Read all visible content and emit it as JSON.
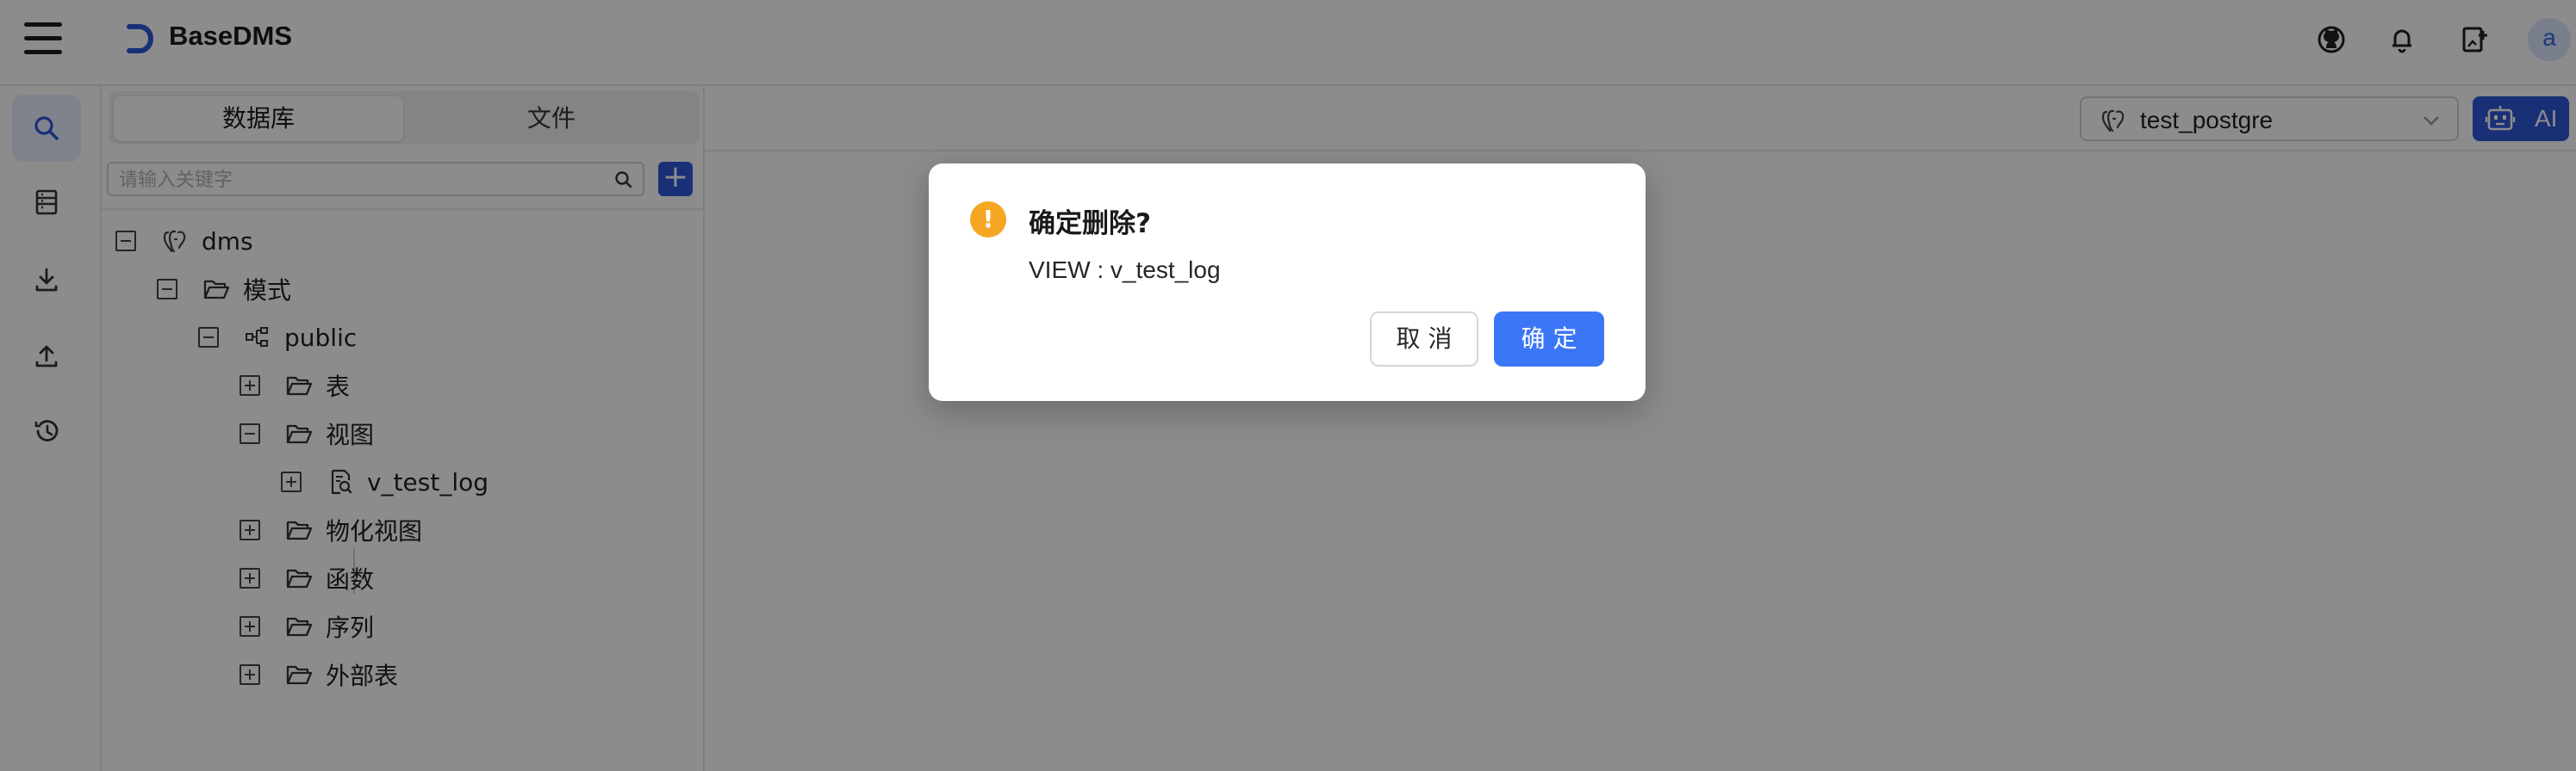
{
  "app": {
    "title": "BaseDMS"
  },
  "header": {
    "icons": [
      "github-icon",
      "bell-icon",
      "add-document-icon"
    ],
    "avatar": "a"
  },
  "leftnav": {
    "items": [
      {
        "icon": "search-icon",
        "active": true
      },
      {
        "icon": "database-icon",
        "active": false
      },
      {
        "icon": "download-icon",
        "active": false
      },
      {
        "icon": "upload-icon",
        "active": false
      },
      {
        "icon": "history-icon",
        "active": false
      }
    ]
  },
  "tree_panel": {
    "tabs": [
      {
        "label": "数据库",
        "selected": true
      },
      {
        "label": "文件",
        "selected": false
      }
    ],
    "search": {
      "placeholder": "请输入关键字",
      "value": ""
    },
    "add_label": "+",
    "nodes": [
      {
        "label": "dms",
        "icon": "postgres-icon",
        "expanded": true,
        "depth": 0
      },
      {
        "label": "模式",
        "icon": "folder-open-icon",
        "expanded": true,
        "depth": 1
      },
      {
        "label": "public",
        "icon": "schema-icon",
        "expanded": true,
        "depth": 2
      },
      {
        "label": "表",
        "icon": "folder-open-icon",
        "expanded": false,
        "depth": 3
      },
      {
        "label": "视图",
        "icon": "folder-open-icon",
        "expanded": true,
        "depth": 3
      },
      {
        "label": "v_test_log",
        "icon": "view-icon",
        "expanded": false,
        "depth": 4
      },
      {
        "label": "物化视图",
        "icon": "folder-open-icon",
        "expanded": false,
        "depth": 3
      },
      {
        "label": "函数",
        "icon": "folder-open-icon",
        "expanded": false,
        "depth": 3
      },
      {
        "label": "序列",
        "icon": "folder-open-icon",
        "expanded": false,
        "depth": 3
      },
      {
        "label": "外部表",
        "icon": "folder-open-icon",
        "expanded": false,
        "depth": 3
      }
    ]
  },
  "main": {
    "db_select": {
      "value": "test_postgre",
      "icon": "postgres-icon"
    },
    "ai_button": {
      "label": "AI",
      "icon": "robot-icon"
    }
  },
  "modal": {
    "title": "确定删除?",
    "content": "VIEW : v_test_log",
    "cancel_label": "取 消",
    "ok_label": "确 定",
    "icon": "!"
  },
  "colors": {
    "primary": "#2f56d8",
    "ok_button": "#3b76f6",
    "warning": "#f5a623"
  }
}
